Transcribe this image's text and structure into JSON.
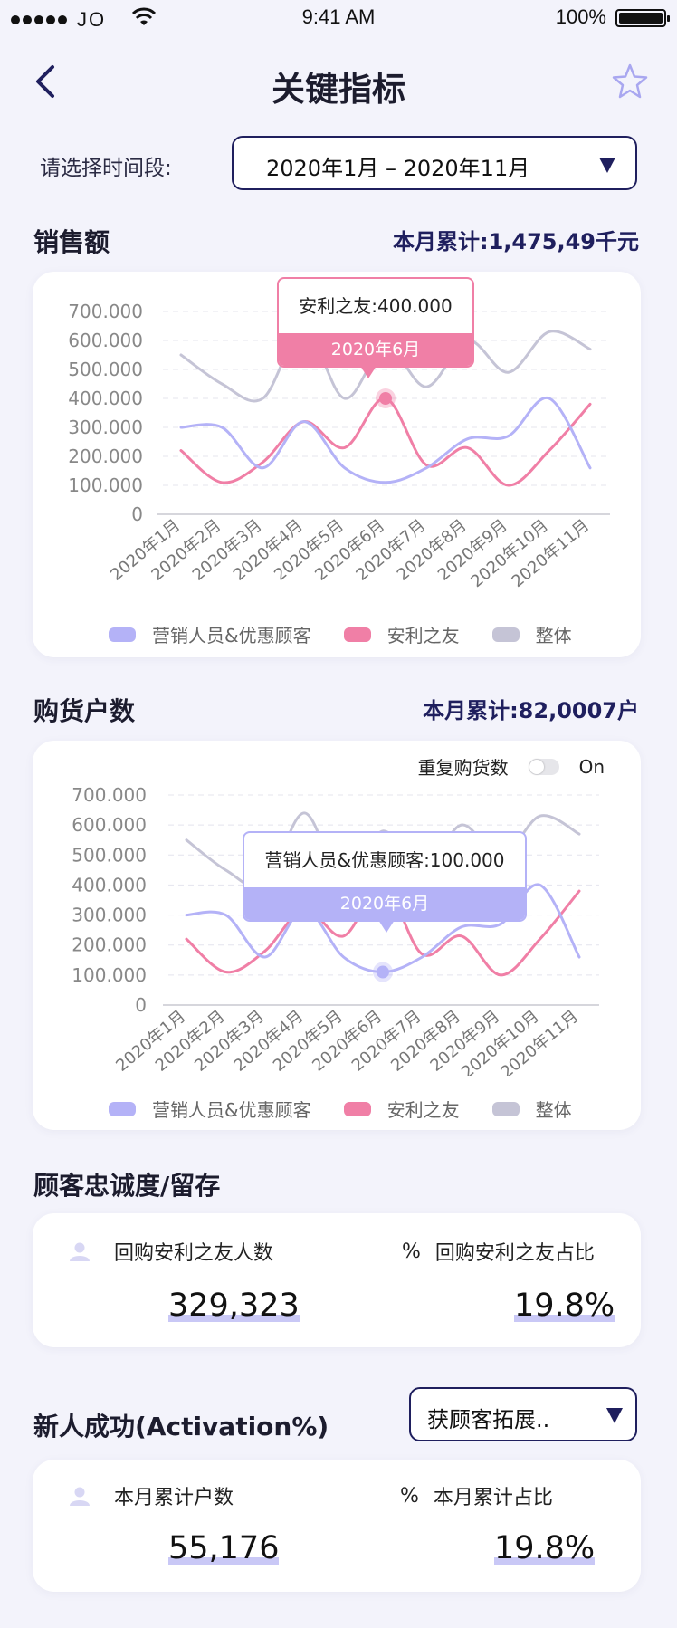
{
  "status_bar": {
    "carrier": "JO",
    "time": "9:41 AM",
    "battery": "100%"
  },
  "nav": {
    "title": "关键指标",
    "back_icon": "chevron-left-icon",
    "star_icon": "star-outline-icon"
  },
  "period": {
    "label": "请选择时间段:",
    "value": "2020年1月 – 2020年11月"
  },
  "sales": {
    "title": "销售额",
    "total": "本月累计:1,475,49千元",
    "tooltip": {
      "label": "安利之友:400.000",
      "date": "2020年6月"
    }
  },
  "households": {
    "title": "购货户数",
    "total": "本月累计:82,0007户",
    "toggle_label": "重复购货数",
    "toggle_state": "On",
    "tooltip": {
      "label": "营销人员&优惠顾客:100.000",
      "date": "2020年6月"
    }
  },
  "loyalty": {
    "title": "顾客忠诚度/留存",
    "left_label": "回购安利之友人数",
    "left_value": "329,323",
    "right_label": "回购安利之友占比",
    "right_value": "19.8%"
  },
  "activation": {
    "title": "新人成功(Activation%)",
    "select_value": "获顾客拓展..",
    "left_label": "本月累计户数",
    "left_value": "55,176",
    "right_label": "本月累计占比",
    "right_value": "19.8%"
  },
  "colors": {
    "series1": "#b4b2f7",
    "series2": "#f07fa6",
    "series3": "#c5c4d6",
    "accent": "#1f1f5e"
  },
  "chart_data": [
    {
      "type": "line",
      "categories": [
        "2020年1月",
        "2020年2月",
        "2020年3月",
        "2020年4月",
        "2020年5月",
        "2020年6月",
        "2020年7月",
        "2020年8月",
        "2020年9月",
        "2020年10月",
        "2020年11月"
      ],
      "yticks": [
        "700.000",
        "600.000",
        "500.000",
        "400.000",
        "300.000",
        "200.000",
        "100.000",
        "0"
      ],
      "ylim": [
        0,
        700
      ],
      "legend_position": "bottom",
      "series": [
        {
          "name": "营销人员&优惠顾客",
          "values": [
            300,
            300,
            160,
            320,
            160,
            110,
            160,
            260,
            270,
            400,
            160
          ]
        },
        {
          "name": "安利之友",
          "values": [
            220,
            110,
            180,
            320,
            230,
            400,
            170,
            230,
            100,
            220,
            380
          ]
        },
        {
          "name": "整体",
          "values": [
            550,
            450,
            400,
            640,
            400,
            580,
            440,
            600,
            490,
            630,
            570
          ]
        }
      ]
    },
    {
      "type": "line",
      "categories": [
        "2020年1月",
        "2020年2月",
        "2020年3月",
        "2020年4月",
        "2020年5月",
        "2020年6月",
        "2020年7月",
        "2020年8月",
        "2020年9月",
        "2020年10月",
        "2020年11月"
      ],
      "yticks": [
        "700.000",
        "600.000",
        "500.000",
        "400.000",
        "300.000",
        "200.000",
        "100.000",
        "0"
      ],
      "ylim": [
        0,
        700
      ],
      "legend_position": "bottom",
      "series": [
        {
          "name": "营销人员&优惠顾客",
          "values": [
            300,
            300,
            160,
            320,
            160,
            110,
            160,
            260,
            270,
            400,
            160
          ]
        },
        {
          "name": "安利之友",
          "values": [
            220,
            110,
            180,
            320,
            230,
            400,
            170,
            230,
            100,
            220,
            380
          ]
        },
        {
          "name": "整体",
          "values": [
            550,
            450,
            400,
            640,
            400,
            580,
            440,
            600,
            490,
            630,
            570
          ]
        }
      ]
    }
  ]
}
